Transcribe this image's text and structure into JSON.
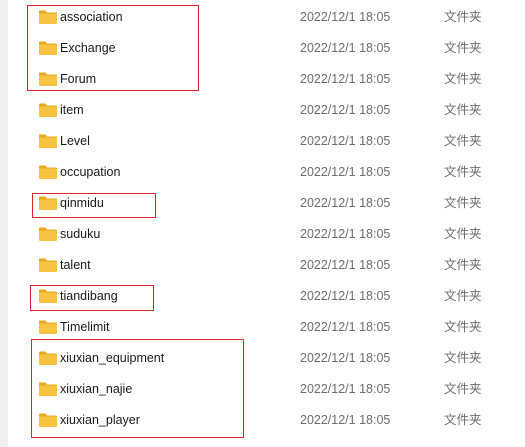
{
  "folders": [
    {
      "name": "association",
      "modified": "2022/12/1 18:05",
      "type": "文件夹"
    },
    {
      "name": "Exchange",
      "modified": "2022/12/1 18:05",
      "type": "文件夹"
    },
    {
      "name": "Forum",
      "modified": "2022/12/1 18:05",
      "type": "文件夹"
    },
    {
      "name": "item",
      "modified": "2022/12/1 18:05",
      "type": "文件夹"
    },
    {
      "name": "Level",
      "modified": "2022/12/1 18:05",
      "type": "文件夹"
    },
    {
      "name": "occupation",
      "modified": "2022/12/1 18:05",
      "type": "文件夹"
    },
    {
      "name": "qinmidu",
      "modified": "2022/12/1 18:05",
      "type": "文件夹"
    },
    {
      "name": "suduku",
      "modified": "2022/12/1 18:05",
      "type": "文件夹"
    },
    {
      "name": "talent",
      "modified": "2022/12/1 18:05",
      "type": "文件夹"
    },
    {
      "name": "tiandibang",
      "modified": "2022/12/1 18:05",
      "type": "文件夹"
    },
    {
      "name": "Timelimit",
      "modified": "2022/12/1 18:05",
      "type": "文件夹"
    },
    {
      "name": "xiuxian_equipment",
      "modified": "2022/12/1 18:05",
      "type": "文件夹"
    },
    {
      "name": "xiuxian_najie",
      "modified": "2022/12/1 18:05",
      "type": "文件夹"
    },
    {
      "name": "xiuxian_player",
      "modified": "2022/12/1 18:05",
      "type": "文件夹"
    }
  ],
  "colors": {
    "folder_body": "#f5c242",
    "folder_tab": "#e8a81c",
    "highlight_border": "#e0262c"
  },
  "icons": {
    "folder": "folder-icon"
  }
}
